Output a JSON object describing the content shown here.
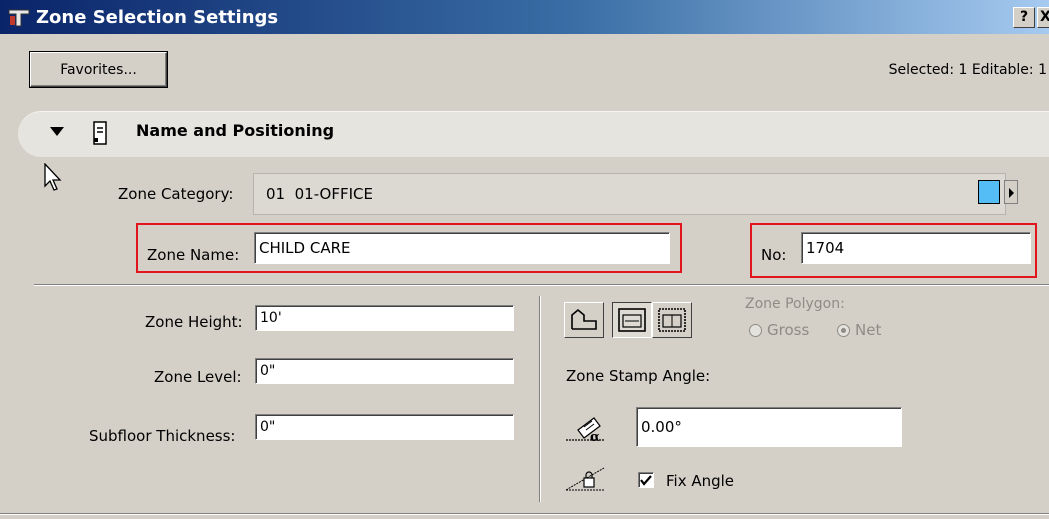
{
  "window": {
    "title": "Zone Selection Settings",
    "help_label": "?",
    "close_label": "X"
  },
  "toolbar": {
    "favorites_label": "Favorites...",
    "selected_info": "Selected: 1 Editable: 1"
  },
  "panel": {
    "title": "Name and Positioning"
  },
  "category": {
    "label": "Zone Category:",
    "value": "01  01-OFFICE",
    "swatch_color": "#55bdf5"
  },
  "name": {
    "label": "Zone Name:",
    "value": "CHILD CARE"
  },
  "number": {
    "label": "No:",
    "value": "1704"
  },
  "height": {
    "label": "Zone Height:",
    "value": "10'"
  },
  "level": {
    "label": "Zone Level:",
    "value": "0\""
  },
  "subfloor": {
    "label": "Subfloor Thickness:",
    "value": "0\""
  },
  "polygon": {
    "label": "Zone Polygon:",
    "gross_label": "Gross",
    "net_label": "Net",
    "selected": "Net"
  },
  "stamp": {
    "label": "Zone Stamp Angle:",
    "angle_value": "0.00°",
    "fix_angle_label": "Fix Angle",
    "fix_angle_checked": true
  },
  "colors": {
    "highlight": "#e2141c",
    "titlebar": "#0a246a"
  }
}
